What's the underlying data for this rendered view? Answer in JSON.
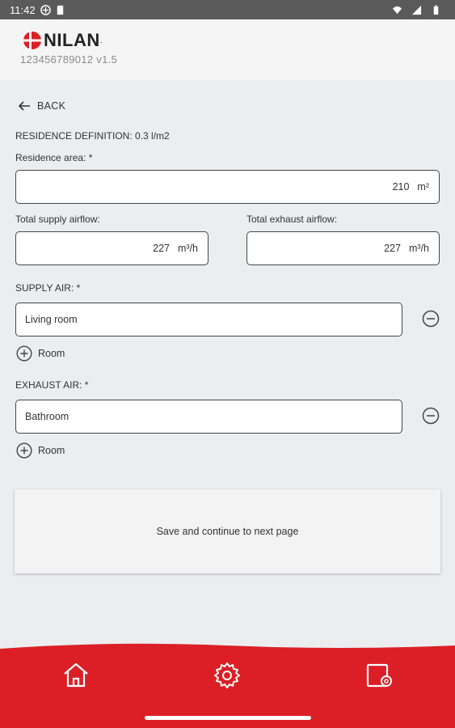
{
  "status_bar": {
    "time": "11:42"
  },
  "header": {
    "brand": "NILAN",
    "version": "123456789012 v1.5"
  },
  "back": {
    "label": "BACK"
  },
  "residence_definition": "RESIDENCE DEFINITION: 0.3 l/m2",
  "residence_area": {
    "label": "Residence area: *",
    "value": "210",
    "unit": "m²"
  },
  "supply_airflow": {
    "label": "Total supply airflow:",
    "value": "227",
    "unit": "m³/h"
  },
  "exhaust_airflow": {
    "label": "Total exhaust airflow:",
    "value": "227",
    "unit": "m³/h"
  },
  "supply_air": {
    "label": "SUPPLY AIR: *",
    "room": "Living room",
    "add_label": "Room"
  },
  "exhaust_air": {
    "label": "EXHAUST AIR: *",
    "room": "Bathroom",
    "add_label": "Room"
  },
  "save_button": "Save and continue to next page",
  "colors": {
    "brand_red": "#dc1f26",
    "background": "#ecedef"
  },
  "bottom_nav": {
    "icons": [
      "home-icon",
      "settings-icon",
      "device-settings-icon"
    ]
  }
}
